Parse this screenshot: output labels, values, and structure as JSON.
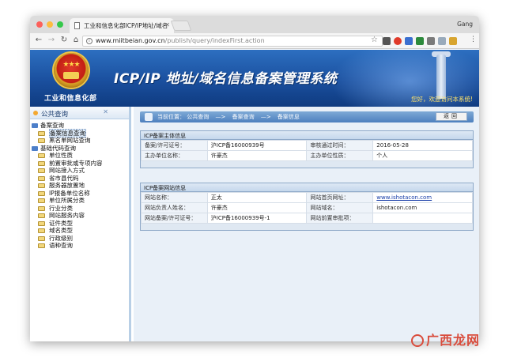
{
  "browser": {
    "tab_title": "工业和信息化部ICP/IP地址/域名",
    "tab_close": "✕",
    "profile_name": "Gang",
    "url_host": "www.miitbeian.gov.cn",
    "url_path": "/publish/query/indexFirst.action",
    "icons": [
      "back-arrow-icon",
      "forward-arrow-icon",
      "reload-icon",
      "home-icon",
      "info-icon",
      "star-icon",
      "menu-dots-icon"
    ],
    "colors": {
      "tab_bg": "#dcdcdc",
      "toolbar_bg": "#f5f5f5"
    }
  },
  "header": {
    "ministry_label": "工业和信息化部",
    "system_title": "ICP/IP 地址/域名信息备案管理系统",
    "welcome": "您好，欢迎访问本系统!",
    "colors": {
      "banner": "#1a4f9e",
      "welcome": "#ffe36a"
    }
  },
  "sidebar": {
    "heading": "公共查询",
    "collapse_glyph": "✕",
    "groups": [
      {
        "label": "备案查询",
        "items": [
          {
            "label": "备案信息查询",
            "selected": true
          },
          {
            "label": "黑名单网站查询",
            "selected": false
          }
        ]
      },
      {
        "label": "基础代码查询",
        "items": [
          {
            "label": "单位性质"
          },
          {
            "label": "前置审批或专项内容"
          },
          {
            "label": "网站接入方式"
          },
          {
            "label": "省市县代码"
          },
          {
            "label": "服务器放置地"
          },
          {
            "label": "IP报备单位名称"
          },
          {
            "label": "单位所属分类"
          },
          {
            "label": "行业分类"
          },
          {
            "label": "网站服务内容"
          },
          {
            "label": "证件类型"
          },
          {
            "label": "域名类型"
          },
          {
            "label": "行政级别"
          },
          {
            "label": "语种查询"
          }
        ]
      }
    ]
  },
  "breadcrumb": {
    "prefix": "当前位置：",
    "items": [
      "公共查询",
      "备案查询",
      "备案信息"
    ],
    "separator": "—>",
    "back_label": "返回"
  },
  "subject_panel": {
    "title": "ICP备案主体信息",
    "rows": [
      [
        "备案/许可证号：",
        "沪ICP备16000939号",
        "审核通过时间：",
        "2016-05-28"
      ],
      [
        "主办单位名称：",
        "许豪杰",
        "主办单位性质：",
        "个人"
      ]
    ]
  },
  "site_panel": {
    "title": "ICP备案网站信息",
    "rows": [
      [
        "网站名称：",
        "正太",
        "网站首页网址：",
        "www.ishotacon.com"
      ],
      [
        "网站负责人姓名：",
        "许豪杰",
        "网站域名：",
        "ishotacon.com"
      ],
      [
        "网站备案/许可证号：",
        "沪ICP备16000939号-1",
        "网站前置审批项：",
        ""
      ]
    ]
  },
  "watermark": {
    "text": "广西龙网"
  }
}
